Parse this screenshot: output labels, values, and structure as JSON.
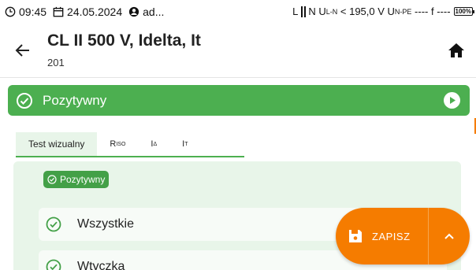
{
  "status_bar": {
    "time": "09:45",
    "date": "24.05.2024",
    "user": "ad...",
    "voltage_prefix": "L",
    "voltage_text_1": "N U",
    "voltage_sub_1": "L-N",
    "voltage_text_2": " < 195,0 V U",
    "voltage_sub_2": "N-PE",
    "voltage_text_3": " ---- f ----",
    "battery": "100%"
  },
  "header": {
    "title": "CL II 500 V, Idelta, It",
    "subtitle": "201"
  },
  "result": {
    "label": "Pozytywny"
  },
  "tabs": [
    {
      "label": "Test wizualny"
    },
    {
      "label_main": "R",
      "label_sub": "ISO"
    },
    {
      "label_main": "I",
      "label_sub": "Δ"
    },
    {
      "label_main": "I",
      "label_sub": "T"
    }
  ],
  "panel": {
    "badge": "Pozytywny",
    "items": [
      {
        "label": "Wszystkie"
      },
      {
        "label": "Wtyczka"
      }
    ]
  },
  "fab": {
    "save_label": "ZAPISZ"
  },
  "colors": {
    "green": "#4caf50",
    "light_green": "#e8f5e9",
    "orange": "#f57c00"
  }
}
